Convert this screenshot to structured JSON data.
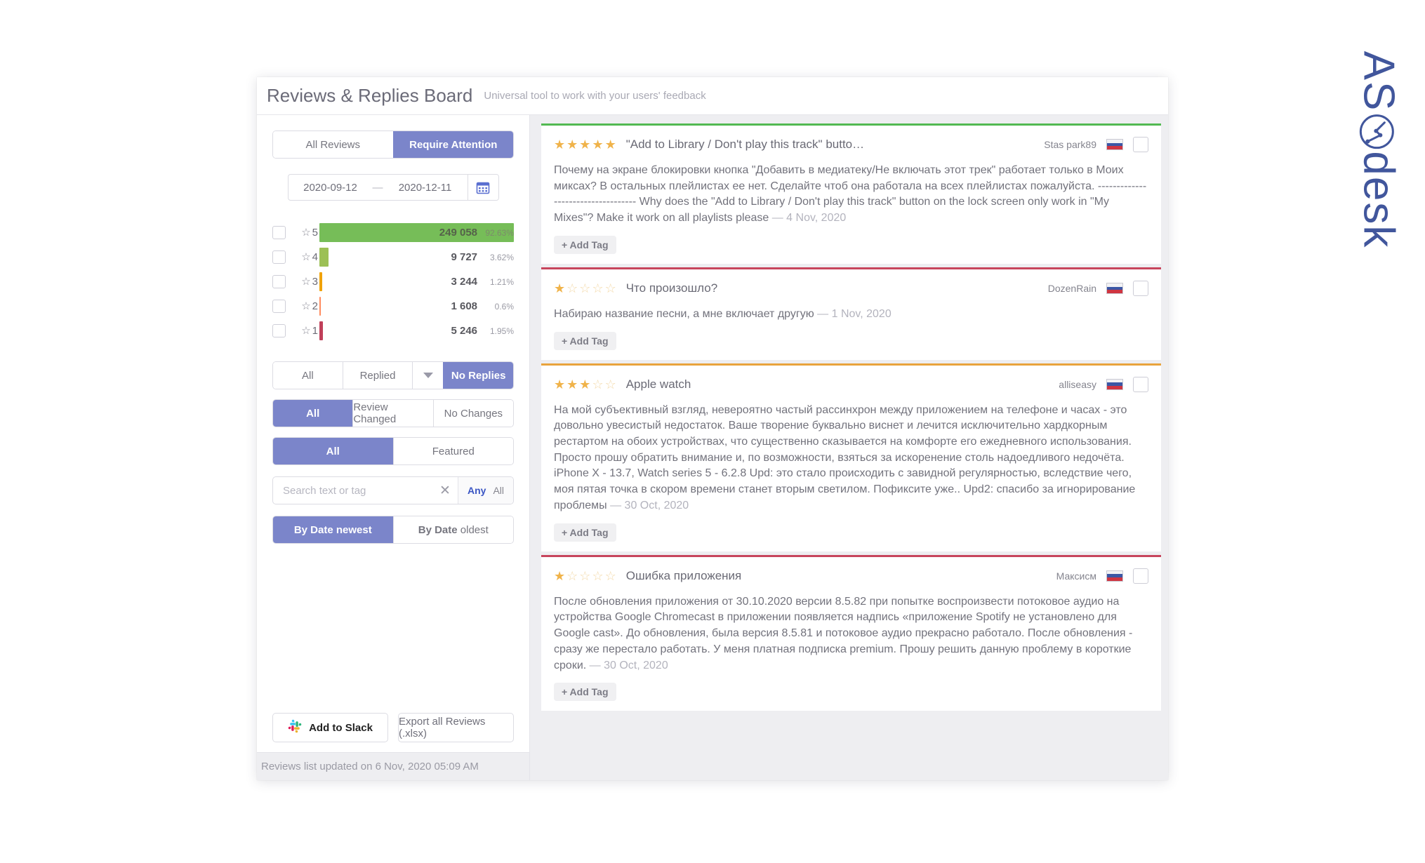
{
  "brand": {
    "logo_text": "ASdesk",
    "logo_full": "ASOdesk",
    "logo_color": "#41569c"
  },
  "header": {
    "title": "Reviews & Replies Board",
    "subtitle": "Universal tool to work with your users' feedback"
  },
  "sidebar": {
    "top_tabs": [
      {
        "label": "All Reviews",
        "active": false
      },
      {
        "label": "Require Attention",
        "active": true
      }
    ],
    "date_range": {
      "from": "2020-09-12",
      "dash": "—",
      "to": "2020-12-11",
      "calendar_icon": "calendar-icon"
    },
    "reply_filter": [
      {
        "label": "All",
        "active": false
      },
      {
        "label": "Replied",
        "active": false,
        "has_caret": true
      },
      {
        "label": "No Replies",
        "active": true
      }
    ],
    "change_filter": [
      {
        "label": "All",
        "active": true
      },
      {
        "label": "Review Changed",
        "active": false
      },
      {
        "label": "No Changes",
        "active": false
      }
    ],
    "featured_filter": [
      {
        "label": "All",
        "active": true
      },
      {
        "label": "Featured",
        "active": false
      }
    ],
    "search": {
      "placeholder": "Search text or tag",
      "value": "",
      "clear_icon": "close-icon",
      "modes": [
        {
          "label": "Any",
          "selected": true
        },
        {
          "label": "All",
          "selected": false
        }
      ]
    },
    "sort": [
      {
        "label_bold": "By Date",
        "label_rest": "newest",
        "active": true
      },
      {
        "label_bold": "By Date",
        "label_rest": "oldest",
        "active": false
      }
    ],
    "actions": {
      "slack": "Add to Slack",
      "export": "Export all Reviews (.xlsx)"
    },
    "footer_status": "Reviews list updated on 6 Nov, 2020 05:09 AM"
  },
  "chart_data": {
    "type": "bar",
    "title": "",
    "xlabel": "",
    "ylabel": "",
    "orientation": "horizontal",
    "categories": [
      "5",
      "4",
      "3",
      "2",
      "1"
    ],
    "values": [
      249058,
      9727,
      3244,
      1608,
      5246
    ],
    "value_labels": [
      "249 058",
      "9 727",
      "3 244",
      "1 608",
      "5 246"
    ],
    "percent_labels": [
      "92.63%",
      "3.62%",
      "1.21%",
      "0.6%",
      "1.95%"
    ],
    "percents": [
      92.63,
      3.62,
      1.21,
      0.6,
      1.95
    ],
    "bar_colors": [
      "#76bd58",
      "#9cc055",
      "#f0a202",
      "#ff8b5e",
      "#c0405a"
    ],
    "bar_widths_pct": [
      100,
      5.0,
      2.2,
      1.0,
      2.6
    ],
    "grid": false,
    "legend": "none",
    "checkbox_per_row": true,
    "star_glyph": "☆"
  },
  "reviews": [
    {
      "accent": "#52b952",
      "rating": 5,
      "title": "\"Add to Library / Don't play this track\" butto…",
      "author": "Stas park89",
      "country_flag": "ru-flag-icon",
      "body": "Почему на экране блокировки кнопка \"Добавить в медиатеку/Не включать этот трек\" работает только в Моих миксах? В остальных плейлистах ее нет. Сделайте чтоб она работала на всех плейлистах пожалуйста. ----------------------------------- Why does the \"Add to Library / Don't play this track\" button on the lock screen only work in \"My Mixes\"? Make it work on all playlists please",
      "date": "— 4 Nov, 2020",
      "tag_button": "+ Add Tag"
    },
    {
      "accent": "#c7455c",
      "rating": 1,
      "title": "Что произошло?",
      "author": "DozenRain",
      "country_flag": "ru-flag-icon",
      "body": "Набираю название песни, а мне включает другую",
      "date": "— 1 Nov, 2020",
      "tag_button": "+ Add Tag"
    },
    {
      "accent": "#e8a33d",
      "rating": 3,
      "title": "Apple watch",
      "author": "alliseasy",
      "country_flag": "ru-flag-icon",
      "body": "На мой субъективный взгляд, невероятно частый рассинхрон между приложением на телефоне и часах - это довольно увесистый недостаток. Ваше творение буквально виснет и лечится исключительно хардкорным рестартом на обоих устройствах, что существенно сказывается на комфорте его ежедневного использования. Просто прошу обратить внимание и, по возможности, взяться за искоренение столь надоедливого недочёта. iPhone X - 13.7, Watch series 5 - 6.2.8 Upd: это стало происходить с завидной регулярностью, вследствие чего, моя пятая точка в скором времени станет вторым светилом. Пофиксите уже.. Upd2: спасибо за игнорирование проблемы",
      "date": "— 30 Oct, 2020",
      "tag_button": "+ Add Tag"
    },
    {
      "accent": "#c7455c",
      "rating": 1,
      "title": "Ошибка приложения",
      "author": "Максисм",
      "country_flag": "ru-flag-icon",
      "body": "После обновления приложения от 30.10.2020 версии 8.5.82 при попытке воспроизвести потоковое аудио на устройства Google Chromecast в приложении появляется надпись «приложение Spotify не установлено для Google cast». До обновления, была версия 8.5.81 и потоковое аудио прекрасно работало. После обновления - сразу же перестало работать. У меня платная подписка premium. Прошу решить данную проблему в короткие сроки.",
      "date": "— 30 Oct, 2020",
      "tag_button": "+ Add Tag"
    }
  ]
}
